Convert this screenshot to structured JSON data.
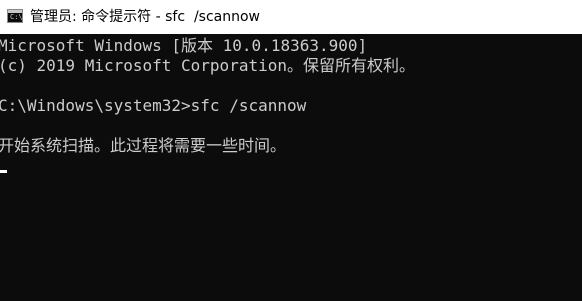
{
  "window": {
    "title": "管理员: 命令提示符 - sfc  /scannow",
    "icon": "cmd-icon",
    "icon_prompt": "C:\\"
  },
  "console": {
    "background": "#0c0c0c",
    "foreground": "#cccccc",
    "lines": [
      "Microsoft Windows [版本 10.0.18363.900]",
      "(c) 2019 Microsoft Corporation。保留所有权利。",
      "C:\\Windows\\system32>sfc /scannow",
      "开始系统扫描。此过程将需要一些时间。"
    ]
  }
}
